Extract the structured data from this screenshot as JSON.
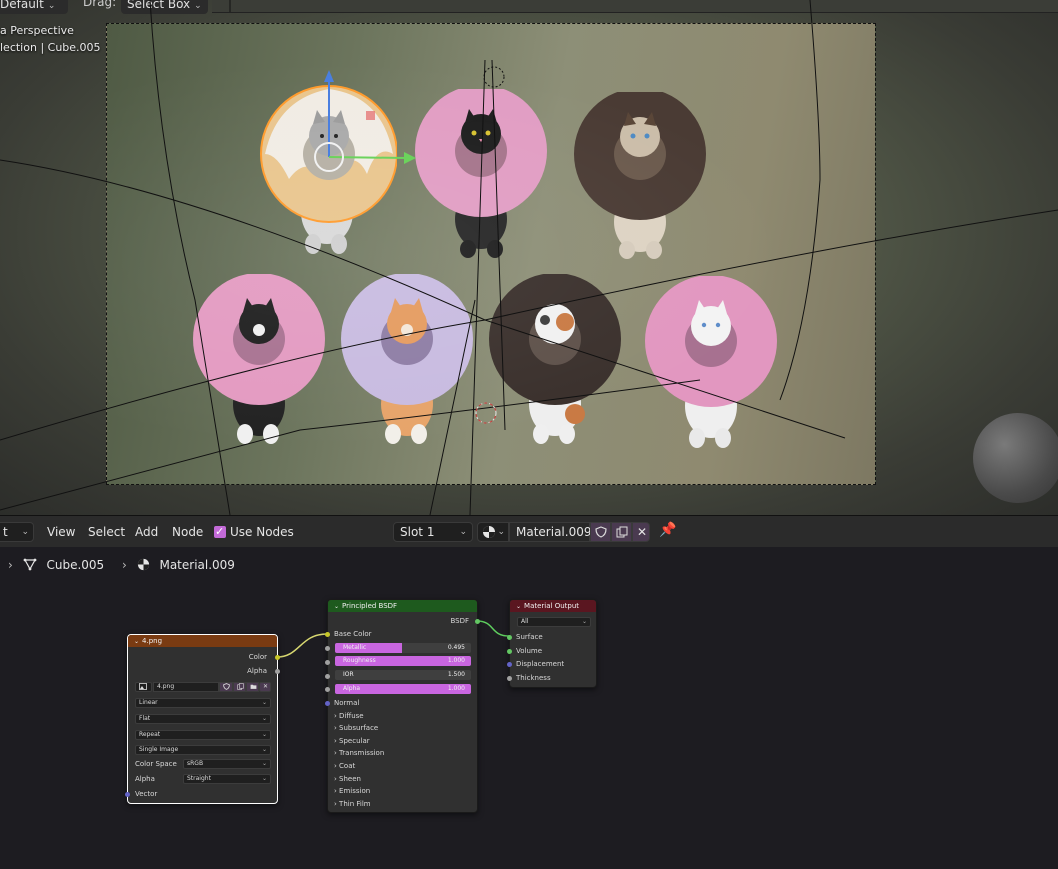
{
  "viewport": {
    "mode_value": "Default",
    "drag_label": "Drag:",
    "drag_value": "Select Box",
    "view_name": "a Perspective",
    "collection_info": "lection | Cube.005"
  },
  "node_editor": {
    "header": {
      "editor_value": "t",
      "menus": [
        "View",
        "Select",
        "Add",
        "Node"
      ],
      "use_nodes_label": "Use Nodes",
      "use_nodes_checked": true,
      "slot_value": "Slot 1",
      "material_value": "Material.009"
    },
    "breadcrumb": {
      "object": "Cube.005",
      "material": "Material.009"
    },
    "image_node": {
      "title": "4.png",
      "outputs": [
        "Color",
        "Alpha"
      ],
      "image_name": "4.png",
      "interpolation": "Linear",
      "projection": "Flat",
      "extension": "Repeat",
      "source": "Single Image",
      "color_space_label": "Color Space",
      "color_space": "sRGB",
      "alpha_label": "Alpha",
      "alpha_mode": "Straight",
      "vector_label": "Vector"
    },
    "bsdf_node": {
      "title": "Principled BSDF",
      "output": "BSDF",
      "base_color_label": "Base Color",
      "metallic_label": "Metallic",
      "metallic_value": "0.495",
      "metallic_fraction": 0.495,
      "roughness_label": "Roughness",
      "roughness_value": "1.000",
      "roughness_fraction": 1.0,
      "ior_label": "IOR",
      "ior_value": "1.500",
      "alpha_label": "Alpha",
      "alpha_value": "1.000",
      "alpha_fraction": 1.0,
      "normal_label": "Normal",
      "panels": [
        "Diffuse",
        "Subsurface",
        "Specular",
        "Transmission",
        "Coat",
        "Sheen",
        "Emission",
        "Thin Film"
      ]
    },
    "output_node": {
      "title": "Material Output",
      "target": "All",
      "inputs": [
        "Surface",
        "Volume",
        "Displacement",
        "Thickness"
      ]
    }
  },
  "colors": {
    "accent": "#c966e0",
    "image_node_header": "#7a3b12",
    "bsdf_header": "#1e5a1e",
    "output_header": "#5a1620",
    "socket_color": "#c7c729",
    "socket_shader": "#63c763",
    "socket_vector": "#6363c7",
    "socket_float": "#a1a1a1"
  }
}
